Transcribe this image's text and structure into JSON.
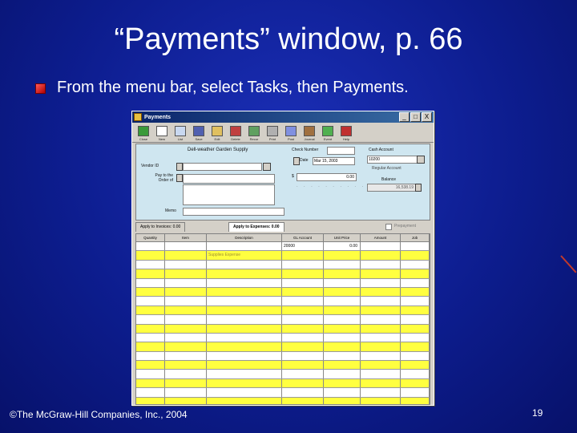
{
  "slide": {
    "title": "“Payments” window, p. 66",
    "bullet": "From the menu bar, select Tasks, then Payments.",
    "footer": "©The McGraw-Hill Companies, Inc., 2004",
    "page_number": "19"
  },
  "window": {
    "title": "Payments",
    "buttons": {
      "minimize": "_",
      "maximize": "□",
      "close": "X"
    },
    "toolbar": [
      "Close",
      "New",
      "List",
      "Save",
      "Edit",
      "Delete",
      "Recur",
      "Print",
      "Post",
      "Journal",
      "Event",
      "Help"
    ],
    "header": {
      "payee_name": "Dell-weather Garden Supply",
      "vendor_id_label": "Vendor ID",
      "pay_to_label": "Pay to the Order of",
      "memo_label": "Memo",
      "check_number_label": "Check Number",
      "date_label": "Date",
      "date_value": "Mar 15, 2003",
      "dollar_sign": "$",
      "amount_value": "0.00",
      "cash_account_label": "Cash Account",
      "cash_account_value": "10200",
      "balance_label": "Balance",
      "balance_value": "16,538.19"
    },
    "tabs": [
      "Apply to Invoices: 0.00",
      "Apply to Expenses: 0.00"
    ],
    "prepayment_label": "Prepayment",
    "grid": {
      "columns": [
        "Quantity",
        "Item",
        "Description",
        "GL Account",
        "Unit Price",
        "Amount",
        "Job"
      ],
      "first_row": {
        "gl_account": "20000",
        "unit_price": "0.00"
      },
      "second_row": {
        "description": "Supplies Expense"
      }
    }
  }
}
